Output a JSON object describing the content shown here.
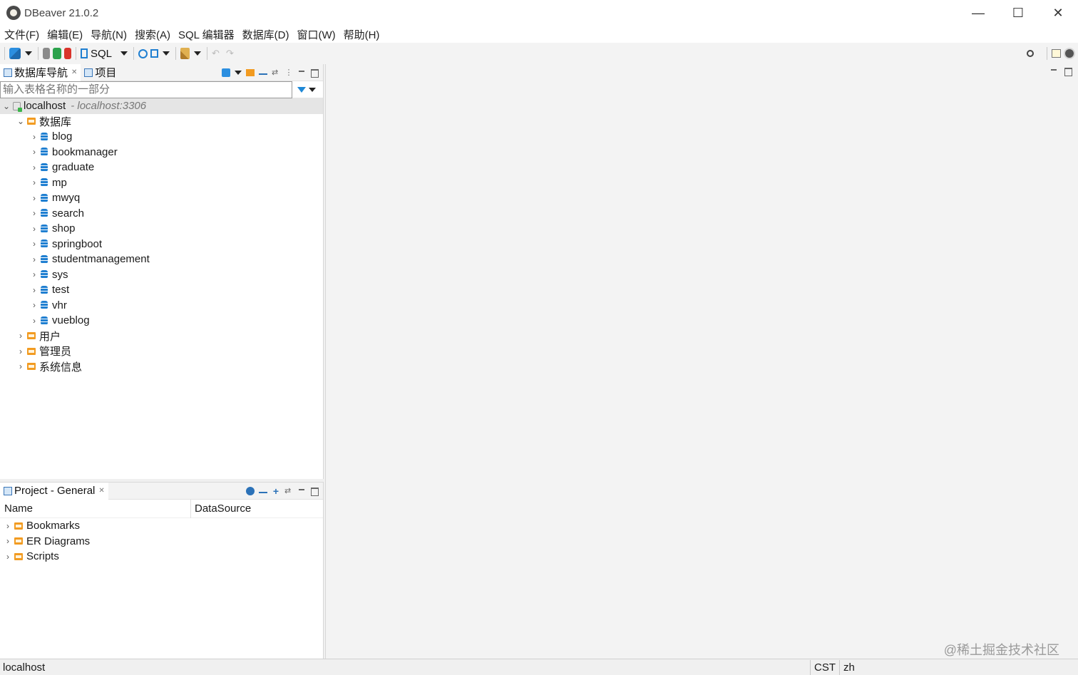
{
  "window": {
    "title": "DBeaver 21.0.2"
  },
  "menu": [
    "文件(F)",
    "编辑(E)",
    "导航(N)",
    "搜索(A)",
    "SQL 编辑器",
    "数据库(D)",
    "窗口(W)",
    "帮助(H)"
  ],
  "toolbar": {
    "sql_label": "SQL"
  },
  "navigator": {
    "tab_label": "数据库导航",
    "tab2_label": "项目",
    "filter_placeholder": "输入表格名称的一部分",
    "connection": {
      "name": "localhost",
      "host": "- localhost:3306"
    },
    "databases_folder": "数据库",
    "databases": [
      "blog",
      "bookmanager",
      "graduate",
      "mp",
      "mwyq",
      "search",
      "shop",
      "springboot",
      "studentmanagement",
      "sys",
      "test",
      "vhr",
      "vueblog"
    ],
    "other_folders": [
      "用户",
      "管理员",
      "系统信息"
    ]
  },
  "project": {
    "tab_label": "Project - General",
    "columns": [
      "Name",
      "DataSource"
    ],
    "items": [
      "Bookmarks",
      "ER Diagrams",
      "Scripts"
    ]
  },
  "status": {
    "left": "localhost",
    "timezone": "CST",
    "locale": "zh"
  },
  "watermark": "@稀土掘金技术社区",
  "colors": {
    "accent": "#1f7fd1",
    "folder": "#f29b21"
  }
}
